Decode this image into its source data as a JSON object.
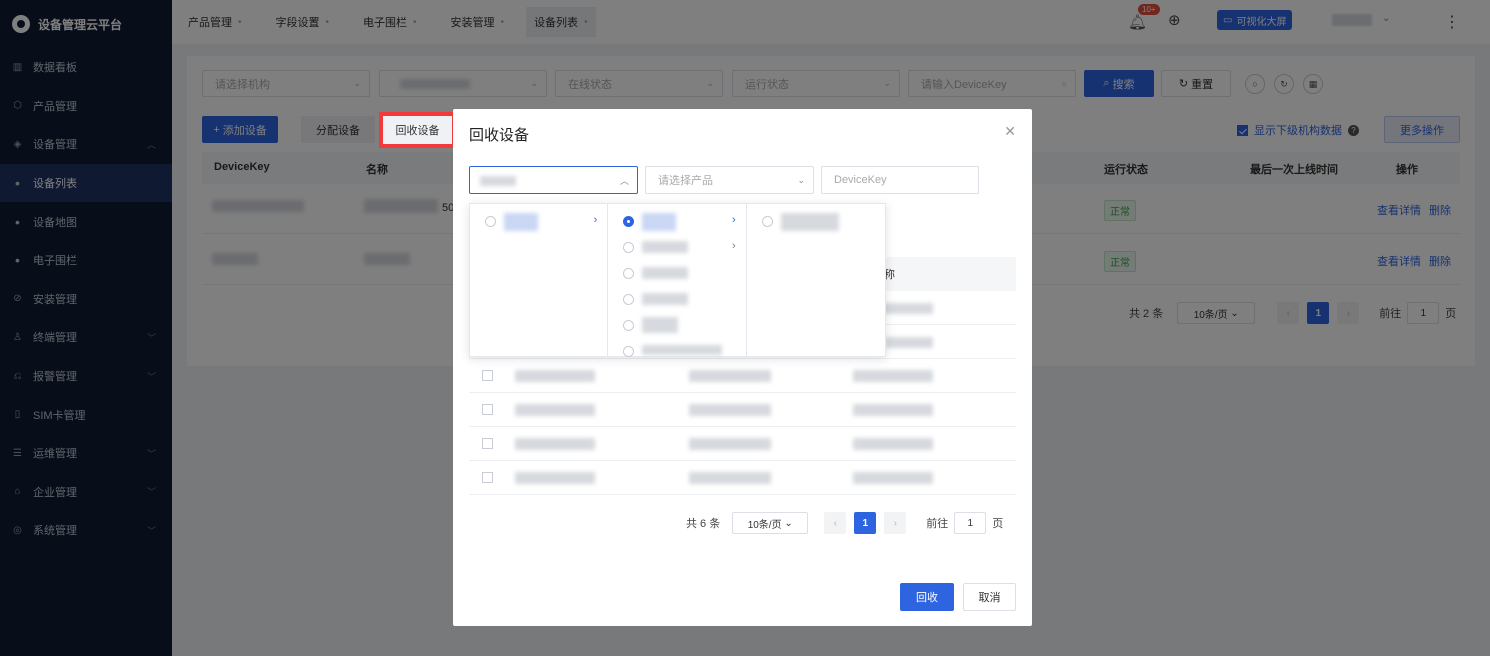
{
  "brand": {
    "title": "设备管理云平台"
  },
  "sidebar": {
    "items": [
      {
        "label": "数据看板",
        "icon": "chart-icon"
      },
      {
        "label": "产品管理",
        "icon": "cube-icon"
      },
      {
        "label": "设备管理",
        "icon": "device-icon",
        "expanded": true
      },
      {
        "label": "设备列表",
        "sub": true,
        "active": true
      },
      {
        "label": "设备地图",
        "sub": true
      },
      {
        "label": "电子围栏",
        "sub": true
      },
      {
        "label": "安装管理",
        "icon": "install-icon"
      },
      {
        "label": "终端管理",
        "icon": "user-icon",
        "chevron": true
      },
      {
        "label": "报警管理",
        "icon": "alarm-icon",
        "chevron": true
      },
      {
        "label": "SIM卡管理",
        "icon": "sim-icon"
      },
      {
        "label": "运维管理",
        "icon": "ops-icon",
        "chevron": true
      },
      {
        "label": "企业管理",
        "icon": "company-icon",
        "chevron": true
      },
      {
        "label": "系统管理",
        "icon": "settings-icon",
        "chevron": true
      }
    ]
  },
  "topbar": {
    "tabs": [
      "产品管理",
      "字段设置",
      "电子围栏",
      "安装管理",
      "设备列表"
    ],
    "notification_badge": "10+",
    "bigscreen_label": "可视化大屏"
  },
  "filters": {
    "org_placeholder": "请选择机构",
    "online_placeholder": "在线状态",
    "run_placeholder": "运行状态",
    "devicekey_placeholder": "请输入DeviceKey",
    "search_label": "搜索",
    "reset_label": "重置"
  },
  "toolbar": {
    "add_label": "添加设备",
    "assign_label": "分配设备",
    "recycle_label": "回收设备",
    "show_sub_label": "显示下级机构数据",
    "more_label": "更多操作"
  },
  "table": {
    "headers": {
      "devicekey": "DeviceKey",
      "name": "名称",
      "run_status": "运行状态",
      "last_online": "最后一次上线时间",
      "action": "操作"
    },
    "rows": [
      {
        "status": "正常",
        "view": "查看详情",
        "delete": "删除",
        "name_suffix": "50"
      },
      {
        "status": "正常",
        "view": "查看详情",
        "delete": "删除"
      }
    ],
    "pager": {
      "total": "共 2 条",
      "size": "10条/页",
      "current": "1",
      "goto": "前往",
      "goto_value": "1",
      "page_unit": "页"
    }
  },
  "modal": {
    "title": "回收设备",
    "product_placeholder": "请选择产品",
    "devicekey_placeholder": "DeviceKey",
    "col_name_partial": "称",
    "pager": {
      "total": "共 6 条",
      "size": "10条/页",
      "current": "1",
      "goto": "前往",
      "goto_value": "1",
      "page_unit": "页"
    },
    "confirm_label": "回收",
    "cancel_label": "取消"
  },
  "colors": {
    "primary": "#2e64e0",
    "sidebar": "#0f1a33",
    "highlight": "#f23a3a",
    "success": "#3aa14c"
  }
}
